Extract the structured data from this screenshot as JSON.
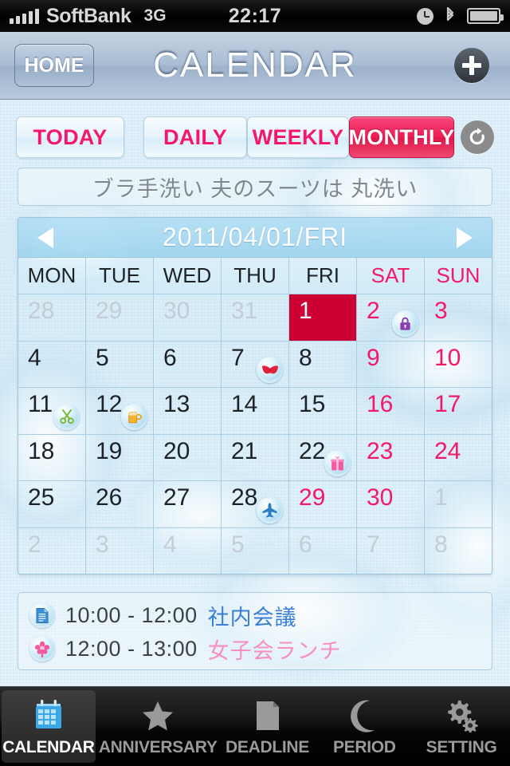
{
  "statusbar": {
    "carrier": "SoftBank",
    "network": "3G",
    "time": "22:17",
    "icons": [
      "signal-bars-icon",
      "alarm-clock-icon",
      "bluetooth-icon",
      "battery-icon"
    ]
  },
  "navbar": {
    "back_label": "HOME",
    "title": "CALENDAR",
    "add_label": "+"
  },
  "filters": {
    "today": "TODAY",
    "daily": "DAILY",
    "weekly": "WEEKLY",
    "monthly": "MONTHLY",
    "active": "MONTHLY",
    "refresh_icon": "refresh-icon"
  },
  "memo": {
    "text": "ブラ手洗い 夫のスーツは 丸洗い"
  },
  "calendar": {
    "date_label": "2011/04/01/FRI",
    "prev_label": "◀",
    "next_label": "▶",
    "dow": [
      "MON",
      "TUE",
      "WED",
      "THU",
      "FRI",
      "SAT",
      "SUN"
    ],
    "weeks": [
      [
        {
          "n": "28",
          "cls": "other"
        },
        {
          "n": "29",
          "cls": "other"
        },
        {
          "n": "30",
          "cls": "other"
        },
        {
          "n": "31",
          "cls": "other"
        },
        {
          "n": "1",
          "cls": "today"
        },
        {
          "n": "2",
          "cls": "we",
          "icon": "lock-icon"
        },
        {
          "n": "3",
          "cls": "we"
        }
      ],
      [
        {
          "n": "4",
          "cls": ""
        },
        {
          "n": "5",
          "cls": ""
        },
        {
          "n": "6",
          "cls": ""
        },
        {
          "n": "7",
          "cls": "",
          "icon": "bra-icon"
        },
        {
          "n": "8",
          "cls": ""
        },
        {
          "n": "9",
          "cls": "we"
        },
        {
          "n": "10",
          "cls": "we"
        }
      ],
      [
        {
          "n": "11",
          "cls": "",
          "icon": "scissors-icon"
        },
        {
          "n": "12",
          "cls": "",
          "icon": "beer-mug-icon"
        },
        {
          "n": "13",
          "cls": ""
        },
        {
          "n": "14",
          "cls": ""
        },
        {
          "n": "15",
          "cls": ""
        },
        {
          "n": "16",
          "cls": "we"
        },
        {
          "n": "17",
          "cls": "we"
        }
      ],
      [
        {
          "n": "18",
          "cls": ""
        },
        {
          "n": "19",
          "cls": ""
        },
        {
          "n": "20",
          "cls": ""
        },
        {
          "n": "21",
          "cls": ""
        },
        {
          "n": "22",
          "cls": "",
          "icon": "gift-icon"
        },
        {
          "n": "23",
          "cls": "we"
        },
        {
          "n": "24",
          "cls": "we"
        }
      ],
      [
        {
          "n": "25",
          "cls": ""
        },
        {
          "n": "26",
          "cls": ""
        },
        {
          "n": "27",
          "cls": ""
        },
        {
          "n": "28",
          "cls": "",
          "icon": "airplane-icon"
        },
        {
          "n": "29",
          "cls": "we"
        },
        {
          "n": "30",
          "cls": "we"
        },
        {
          "n": "1",
          "cls": "other"
        }
      ],
      [
        {
          "n": "2",
          "cls": "other"
        },
        {
          "n": "3",
          "cls": "other"
        },
        {
          "n": "4",
          "cls": "other"
        },
        {
          "n": "5",
          "cls": "other"
        },
        {
          "n": "6",
          "cls": "other"
        },
        {
          "n": "7",
          "cls": "other"
        },
        {
          "n": "8",
          "cls": "other"
        }
      ]
    ]
  },
  "events": [
    {
      "icon": "document-icon",
      "time": "10:00 - 12:00",
      "title": "社内会議",
      "color": "#3b7fd4"
    },
    {
      "icon": "flower-icon",
      "time": "12:00 - 13:00",
      "title": "女子会ランチ",
      "color": "#f78fc0"
    }
  ],
  "tabbar": {
    "items": [
      {
        "label": "CALENDAR",
        "icon": "calendar-icon",
        "active": true
      },
      {
        "label": "ANNIVERSARY",
        "icon": "star-icon",
        "active": false
      },
      {
        "label": "DEADLINE",
        "icon": "document-icon",
        "active": false
      },
      {
        "label": "PERIOD",
        "icon": "moon-icon",
        "active": false
      },
      {
        "label": "SETTING",
        "icon": "gear-icon",
        "active": false
      }
    ]
  },
  "colors": {
    "accent_pink": "#f4186b",
    "today_red": "#cc0033",
    "active_button": "#ee1e55",
    "bg_blue": "#dcedf8"
  }
}
